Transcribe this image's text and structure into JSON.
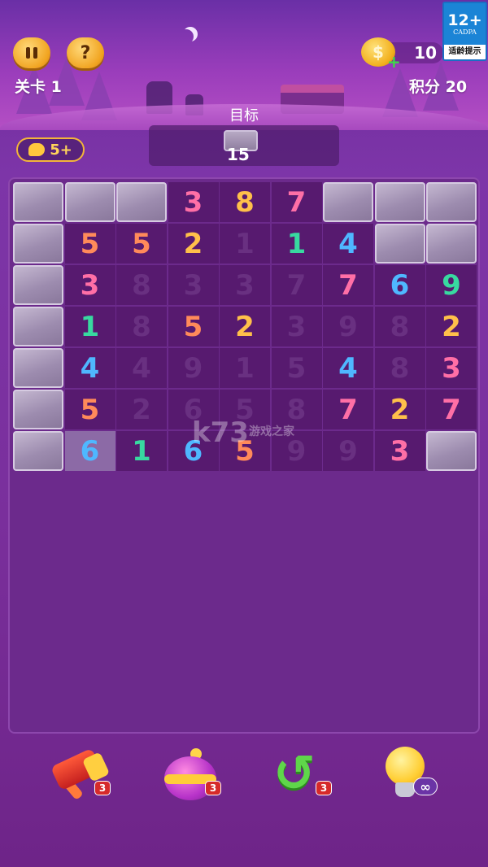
{
  "header": {
    "level_label": "关卡",
    "level_value": "1",
    "score_label": "积分",
    "score_value": "20",
    "coins": "10",
    "help_glyph": "?"
  },
  "age_rating": {
    "number": "12+",
    "org": "CADPA",
    "tip": "适龄提示"
  },
  "target": {
    "label": "目标",
    "count": "15"
  },
  "hint": {
    "value": "5+"
  },
  "grid": {
    "rows": [
      [
        {
          "t": "wall"
        },
        {
          "t": "wall"
        },
        {
          "t": "wall"
        },
        {
          "t": "num",
          "v": "3",
          "c": "#ff6fa6"
        },
        {
          "t": "num",
          "v": "8",
          "c": "#ffc04a"
        },
        {
          "t": "num",
          "v": "7",
          "c": "#ff6fa6"
        },
        {
          "t": "wall"
        },
        {
          "t": "wall"
        },
        {
          "t": "wall"
        }
      ],
      [
        {
          "t": "wall"
        },
        {
          "t": "num",
          "v": "5",
          "c": "#ff8a5a"
        },
        {
          "t": "num",
          "v": "5",
          "c": "#ff8a5a"
        },
        {
          "t": "num",
          "v": "2",
          "c": "#ffc04a"
        },
        {
          "t": "faded",
          "v": "1"
        },
        {
          "t": "num",
          "v": "1",
          "c": "#38d9a0"
        },
        {
          "t": "num",
          "v": "4",
          "c": "#4fb7ff"
        },
        {
          "t": "wall"
        },
        {
          "t": "wall"
        }
      ],
      [
        {
          "t": "wall"
        },
        {
          "t": "num",
          "v": "3",
          "c": "#ff6fa6"
        },
        {
          "t": "faded",
          "v": "8"
        },
        {
          "t": "faded",
          "v": "3"
        },
        {
          "t": "faded",
          "v": "3"
        },
        {
          "t": "faded",
          "v": "7"
        },
        {
          "t": "num",
          "v": "7",
          "c": "#ff6fa6"
        },
        {
          "t": "num",
          "v": "6",
          "c": "#4fb7ff"
        },
        {
          "t": "num",
          "v": "9",
          "c": "#38d9a0"
        }
      ],
      [
        {
          "t": "wall"
        },
        {
          "t": "num",
          "v": "1",
          "c": "#38d9a0"
        },
        {
          "t": "faded",
          "v": "8"
        },
        {
          "t": "num",
          "v": "5",
          "c": "#ff8a5a"
        },
        {
          "t": "num",
          "v": "2",
          "c": "#ffc04a"
        },
        {
          "t": "faded",
          "v": "3"
        },
        {
          "t": "faded",
          "v": "9"
        },
        {
          "t": "faded",
          "v": "8"
        },
        {
          "t": "num",
          "v": "2",
          "c": "#ffc04a"
        }
      ],
      [
        {
          "t": "wall"
        },
        {
          "t": "num",
          "v": "4",
          "c": "#4fb7ff"
        },
        {
          "t": "faded",
          "v": "4"
        },
        {
          "t": "faded",
          "v": "9"
        },
        {
          "t": "faded",
          "v": "1"
        },
        {
          "t": "faded",
          "v": "5"
        },
        {
          "t": "num",
          "v": "4",
          "c": "#4fb7ff"
        },
        {
          "t": "faded",
          "v": "8"
        },
        {
          "t": "num",
          "v": "3",
          "c": "#ff6fa6"
        }
      ],
      [
        {
          "t": "wall"
        },
        {
          "t": "num",
          "v": "5",
          "c": "#ff8a5a"
        },
        {
          "t": "faded",
          "v": "2"
        },
        {
          "t": "faded",
          "v": "6"
        },
        {
          "t": "faded",
          "v": "5"
        },
        {
          "t": "faded",
          "v": "8"
        },
        {
          "t": "num",
          "v": "7",
          "c": "#ff6fa6"
        },
        {
          "t": "num",
          "v": "2",
          "c": "#ffc04a"
        },
        {
          "t": "num",
          "v": "7",
          "c": "#ff6fa6"
        }
      ],
      [
        {
          "t": "wall"
        },
        {
          "t": "sel",
          "v": "6",
          "c": "#4fb7ff"
        },
        {
          "t": "num",
          "v": "1",
          "c": "#38d9a0"
        },
        {
          "t": "num",
          "v": "6",
          "c": "#4fb7ff"
        },
        {
          "t": "num",
          "v": "5",
          "c": "#ff8a5a"
        },
        {
          "t": "faded",
          "v": "9"
        },
        {
          "t": "faded",
          "v": "9"
        },
        {
          "t": "num",
          "v": "3",
          "c": "#ff6fa6"
        },
        {
          "t": "wall"
        }
      ]
    ]
  },
  "tools": [
    {
      "name": "hammer",
      "count": "3"
    },
    {
      "name": "bomb",
      "count": "3"
    },
    {
      "name": "undo",
      "count": "3"
    },
    {
      "name": "hint-bulb",
      "count": "∞"
    }
  ],
  "watermark": {
    "main": "k73",
    "sub": "游戏之家"
  }
}
